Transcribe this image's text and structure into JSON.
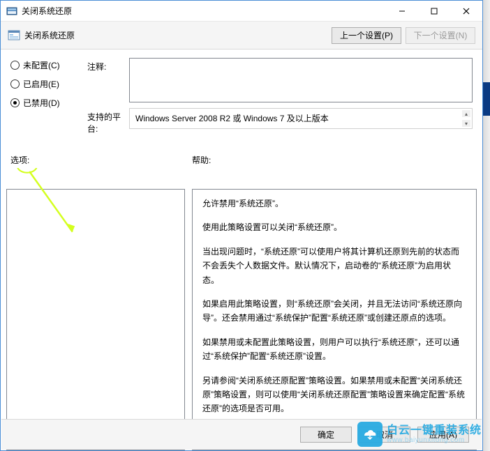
{
  "window": {
    "title": "关闭系统还原"
  },
  "header": {
    "title": "关闭系统还原",
    "prev_btn": "上一个设置(P)",
    "next_btn": "下一个设置(N)"
  },
  "radios": {
    "not_configured": "未配置(C)",
    "enabled": "已启用(E)",
    "disabled": "已禁用(D)",
    "selected": "disabled"
  },
  "labels": {
    "comment": "注释:",
    "supported": "支持的平台:",
    "options": "选项:",
    "help": "帮助:"
  },
  "comment_value": "",
  "supported_value": "Windows Server 2008 R2 或 Windows 7 及以上版本",
  "help_paragraphs": [
    "允许禁用“系统还原”。",
    "使用此策略设置可以关闭“系统还原”。",
    "当出现问题时，“系统还原”可以使用户将其计算机还原到先前的状态而不会丢失个人数据文件。默认情况下，启动卷的“系统还原”为启用状态。",
    "如果启用此策略设置，则“系统还原”会关闭，并且无法访问“系统还原向导”。还会禁用通过“系统保护”配置“系统还原”或创建还原点的选项。",
    "如果禁用或未配置此策略设置，则用户可以执行“系统还原”，还可以通过“系统保护”配置“系统还原”设置。",
    "另请参阅“关闭系统还原配置”策略设置。如果禁用或未配置“关闭系统还原”策略设置，则可以使用“关闭系统还原配置”策略设置来确定配置“系统还原”的选项是否可用。"
  ],
  "buttons": {
    "ok": "确定",
    "cancel": "取消",
    "apply": "应用(A)"
  },
  "watermark": {
    "top": "白云一键重装系统",
    "bottom": "www.baiyunxitong.com"
  }
}
